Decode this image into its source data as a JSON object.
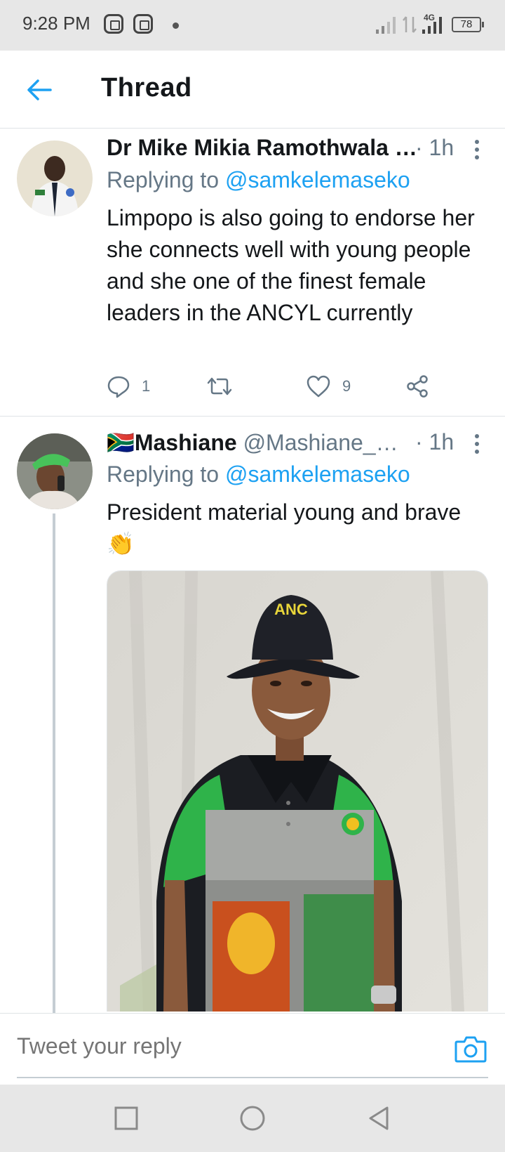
{
  "status_bar": {
    "time": "9:28 PM",
    "network": "4G",
    "battery": "78"
  },
  "header": {
    "title": "Thread",
    "back_icon": "arrow-left-icon"
  },
  "tweets": [
    {
      "name": "Dr Mike Mikia Ramothwala …",
      "handle": "",
      "time": "· 1h",
      "replying_label": "Replying to",
      "replying_handle": "@samkelemaseko",
      "text": "Limpopo is also going to endorse her she connects well with young people and she one of the finest female leaders in the ANCYL currently",
      "replies": "1",
      "retweets": "",
      "likes": "9"
    },
    {
      "flag": "🇿🇦",
      "name": "Mashiane",
      "handle": "@Mashiane_…",
      "time": "· 1h",
      "replying_label": "Replying to",
      "replying_handle": "@samkelemaseko",
      "text": "President material young and brave",
      "emoji": "👏",
      "hat_text": "ANC"
    }
  ],
  "reply_bar": {
    "placeholder": "Tweet your reply",
    "camera_icon": "camera-icon"
  },
  "nav_bar": {
    "icons": [
      "square-icon",
      "circle-icon",
      "triangle-back-icon"
    ]
  },
  "colors": {
    "accent": "#1da1f2",
    "secondary_text": "#657786",
    "primary_text": "#14171a"
  }
}
